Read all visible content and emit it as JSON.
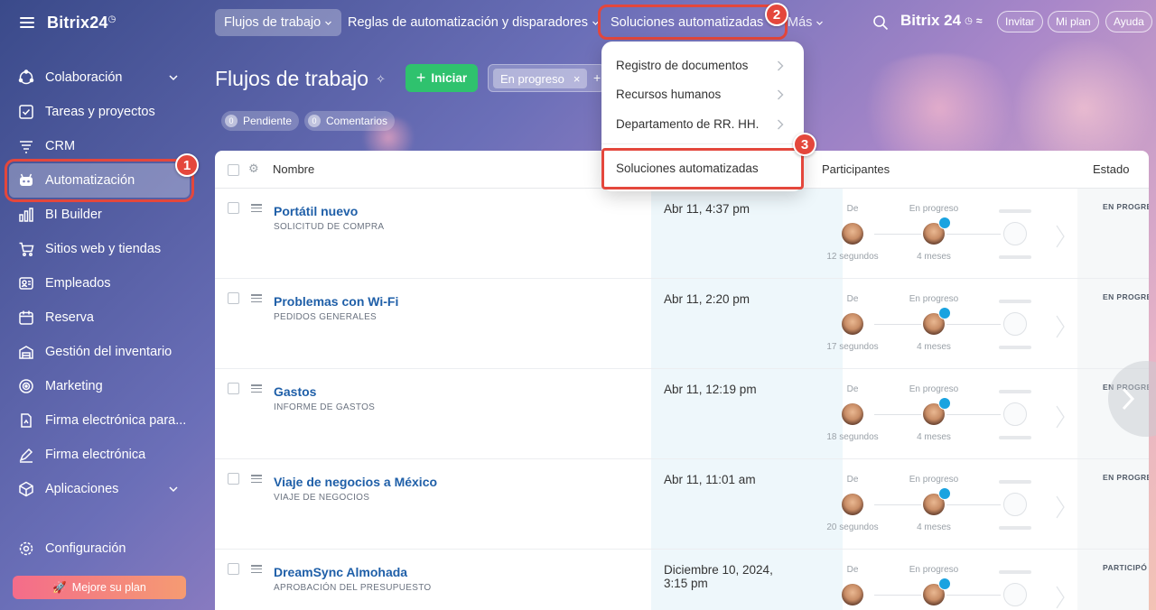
{
  "brand": {
    "name": "Bitrix24",
    "mark": "◷"
  },
  "sidebar": {
    "items": [
      {
        "label": "Colaboración",
        "icon": "collaboration-icon"
      },
      {
        "label": "Tareas y proyectos",
        "icon": "tasks-icon"
      },
      {
        "label": "CRM",
        "icon": "crm-icon"
      },
      {
        "label": "Automatización",
        "icon": "automation-icon"
      },
      {
        "label": "BI Builder",
        "icon": "bi-builder-icon"
      },
      {
        "label": "Sitios web y tiendas",
        "icon": "cart-icon"
      },
      {
        "label": "Empleados",
        "icon": "employees-icon"
      },
      {
        "label": "Reserva",
        "icon": "calendar-icon"
      },
      {
        "label": "Gestión del inventario",
        "icon": "inventory-icon"
      },
      {
        "label": "Marketing",
        "icon": "marketing-icon"
      },
      {
        "label": "Firma electrónica para...",
        "icon": "esign-business-icon"
      },
      {
        "label": "Firma electrónica",
        "icon": "esign-icon"
      },
      {
        "label": "Aplicaciones",
        "icon": "apps-icon"
      }
    ],
    "config_label": "Configuración",
    "upgrade_label": "Mejore su plan"
  },
  "topbar": {
    "tabs": [
      "Flujos de trabajo",
      "Reglas de automatización y disparadores",
      "Soluciones automatizadas",
      "Más"
    ],
    "brand": "Bitrix 24",
    "invite": "Invitar",
    "plan": "Mi plan",
    "help": "Ayuda"
  },
  "header": {
    "title": "Flujos de trabajo",
    "start_label": "Iniciar",
    "filter_chip": "En progreso",
    "counters": [
      {
        "num": "0",
        "label": "Pendiente"
      },
      {
        "num": "0",
        "label": "Comentarios"
      }
    ]
  },
  "dropdown": {
    "items": [
      "Registro de documentos",
      "Recursos humanos",
      "Departamento de RR. HH."
    ],
    "highlight": "Soluciones automatizadas"
  },
  "badges": [
    "1",
    "2",
    "3"
  ],
  "table": {
    "columns": {
      "name": "Nombre",
      "participants": "Participantes",
      "status": "Estado"
    },
    "from_label": "De",
    "progress_label": "En progreso",
    "rows": [
      {
        "title": "Portátil nuevo",
        "sub": "SOLICITUD DE COMPRA",
        "date": "Abr 11, 4:37 pm",
        "from_time": "12 segundos",
        "prog_time": "4 meses",
        "status": "EN PROGRES"
      },
      {
        "title": "Problemas con Wi-Fi",
        "sub": "PEDIDOS GENERALES",
        "date": "Abr 11, 2:20 pm",
        "from_time": "17 segundos",
        "prog_time": "4 meses",
        "status": "EN PROGRES"
      },
      {
        "title": "Gastos",
        "sub": "INFORME DE GASTOS",
        "date": "Abr 11, 12:19 pm",
        "from_time": "18 segundos",
        "prog_time": "4 meses",
        "status": "EN PROGRES"
      },
      {
        "title": "Viaje de negocios a México",
        "sub": "VIAJE DE NEGOCIOS",
        "date": "Abr 11, 11:01 am",
        "from_time": "20 segundos",
        "prog_time": "4 meses",
        "status": "EN PROGRES"
      },
      {
        "title": "DreamSync Almohada",
        "sub": "APROBACIÓN DEL PRESUPUESTO",
        "date": "Diciembre 10, 2024, 3:15 pm",
        "from_time": "",
        "prog_time": "",
        "status": "PARTICIPÓ E"
      }
    ]
  },
  "colors": {
    "accent_red": "#e4473c",
    "start_green": "#2fc26e",
    "link_blue": "#1f5fa8",
    "clock_blue": "#1aa3e0"
  }
}
